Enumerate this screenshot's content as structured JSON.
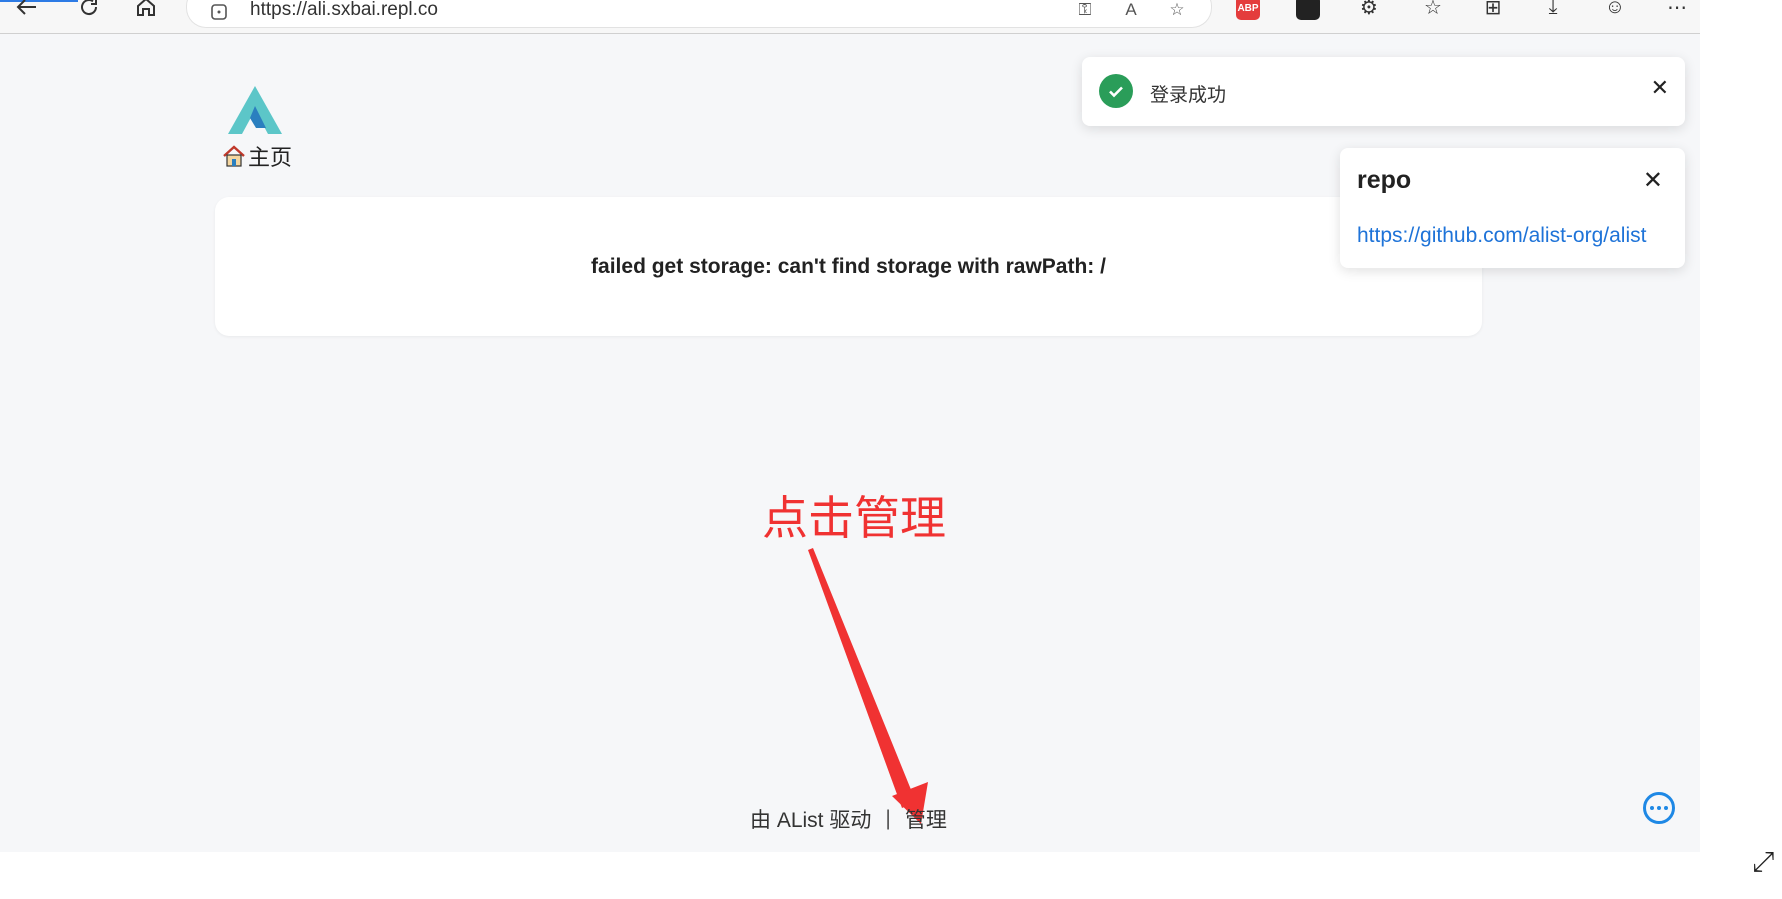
{
  "browser": {
    "url": "https://ali.sxbai.repl.co",
    "extensions": [
      "ABP"
    ]
  },
  "page": {
    "breadcrumb_home": "主页",
    "error_message": "failed get storage: can't find storage with rawPath: /",
    "annotation": "点击管理",
    "footer": {
      "powered_by": "由 AList 驱动",
      "separator": "|",
      "manage": "管理"
    }
  },
  "toasts": {
    "login": {
      "message": "登录成功",
      "close": "✕"
    },
    "repo": {
      "title": "repo",
      "link": "https://github.com/alist-org/alist",
      "close": "✕"
    }
  },
  "colors": {
    "accent": "#1e88e5",
    "success": "#2a9d59",
    "annotation": "#f03232",
    "link": "#1e73d8",
    "logo": "#5cc6c8"
  }
}
